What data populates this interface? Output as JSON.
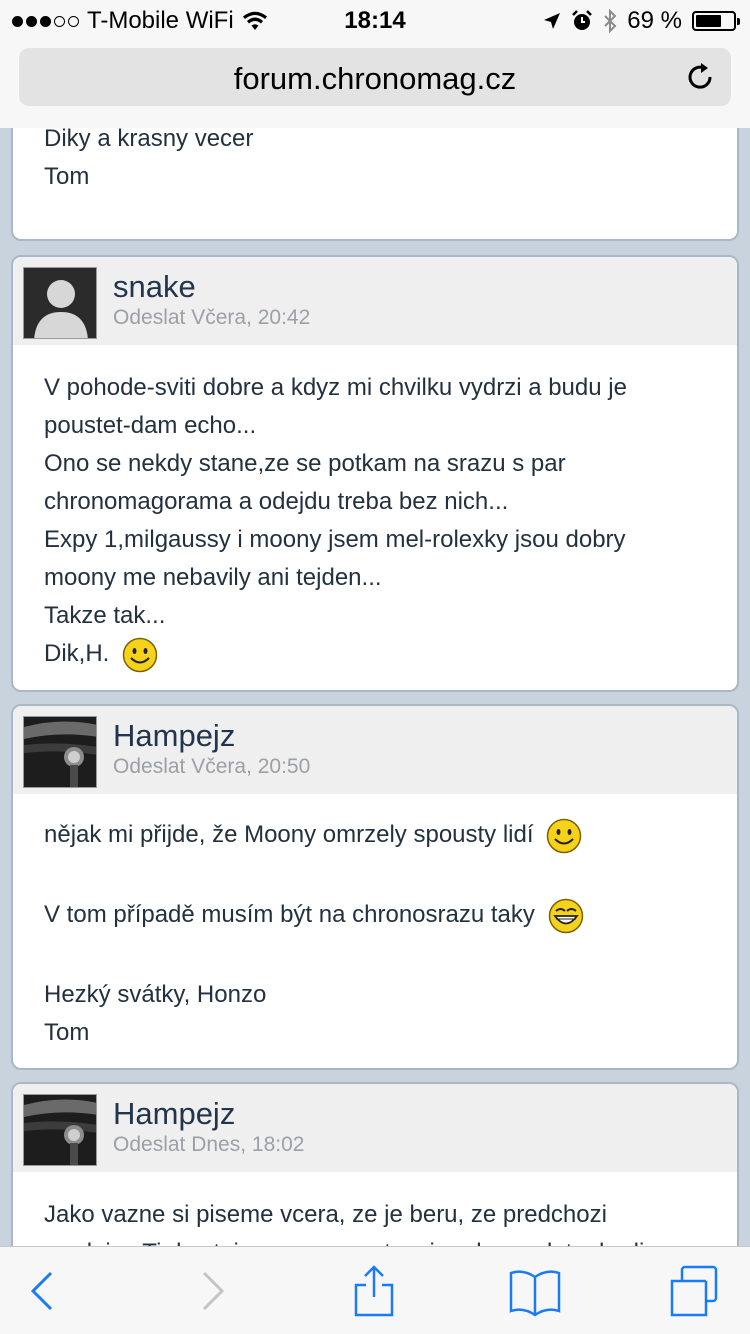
{
  "status": {
    "carrier": "T-Mobile WiFi",
    "time": "18:14",
    "battery": "69 %",
    "battery_level": 0.69,
    "signal_bars": 3,
    "icons": [
      "signal-dots-icon",
      "wifi-icon",
      "location-arrow-icon",
      "alarm-icon",
      "bluetooth-icon",
      "battery-icon"
    ]
  },
  "browser": {
    "url": "forum.chronomag.cz"
  },
  "posts": [
    {
      "lines": [
        "Diky a krasny vecer",
        "Tom"
      ]
    },
    {
      "author": "snake",
      "meta": "Odeslat Včera, 20:42",
      "lines": [
        "V pohode-sviti dobre a kdyz mi chvilku vydrzi a budu je",
        "poustet-dam echo...",
        "Ono se nekdy stane,ze se potkam na srazu s par",
        "chronomagorama a odejdu treba bez nich...",
        "Expy 1,milgaussy i moony jsem mel-rolexky jsou dobry",
        "moony me nebavily ani tejden...",
        "Takze tak...",
        "Dik,H."
      ]
    },
    {
      "author": "Hampejz",
      "meta": "Odeslat Včera, 20:50",
      "lines": [
        "nějak mi přijde, že Moony omrzely spousty lidí",
        "V tom případě musím být na chronosrazu taky",
        "Hezký svátky, Honzo",
        "Tom"
      ]
    },
    {
      "author": "Hampejz",
      "meta": "Odeslat Dnes, 18:02",
      "lines": [
        "Jako vazne si piseme vcera, ze je beru, ze predchozi",
        "prodejce Ti da stejnou zpravu a ty mi podas vedet a hodis"
      ]
    }
  ],
  "toolbar": {
    "icons": [
      "back-icon",
      "forward-icon",
      "share-icon",
      "bookmarks-icon",
      "tabs-icon"
    ]
  },
  "colors": {
    "accent": "#1a7cf5",
    "page_bg": "#c9d3dd",
    "post_border": "#aab7c4",
    "author": "#22354d",
    "meta": "#9ba0a6"
  }
}
